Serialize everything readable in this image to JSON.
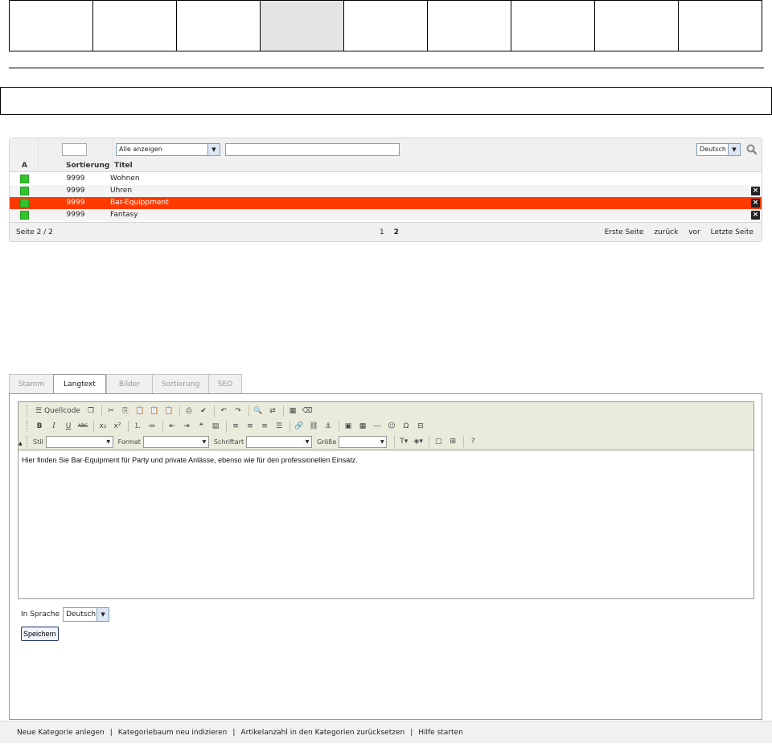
{
  "grid": {
    "headers": {
      "a": "A",
      "sort": "Sortierung",
      "title": "Titel"
    },
    "filter": {
      "select_value": "Alle anzeigen",
      "language": "Deutsch"
    },
    "rows": [
      {
        "sort": "9999",
        "title": "Wohnen",
        "deletable": false
      },
      {
        "sort": "9999",
        "title": "Uhren",
        "deletable": true
      },
      {
        "sort": "9999",
        "title": "Bar-Equippment",
        "deletable": true,
        "selected": true
      },
      {
        "sort": "9999",
        "title": "Fantasy",
        "deletable": true
      }
    ],
    "footer": {
      "page_info": "Seite 2 / 2",
      "pages": [
        "1",
        "2"
      ],
      "nav": {
        "first": "Erste Seite",
        "back": "zurück",
        "next": "vor",
        "last": "Letzte Seite"
      }
    },
    "colors": {
      "selected_row": "#ff3a00",
      "status": "#33c42d"
    }
  },
  "tabs": [
    "Stamm",
    "Langtext",
    "Bilder",
    "Sortierung",
    "SEO"
  ],
  "active_tab": "Langtext",
  "editor": {
    "toolbar": {
      "source": "Quellcode",
      "style_label": "Stil",
      "format_label": "Format",
      "font_label": "Schriftart",
      "size_label": "Größe"
    },
    "content": "Hier finden Sie Bar-Equipment für Party und private Anlässe, ebenso wie für den professionellen Einsatz."
  },
  "language": {
    "label": "In Sprache",
    "value": "Deutsch"
  },
  "save_label": "Speichern",
  "footer_links": [
    "Neue Kategorie anlegen",
    "Kategoriebaum neu indizieren",
    "Artikelanzahl in den Kategorien zurücksetzen",
    "Hilfe starten"
  ]
}
